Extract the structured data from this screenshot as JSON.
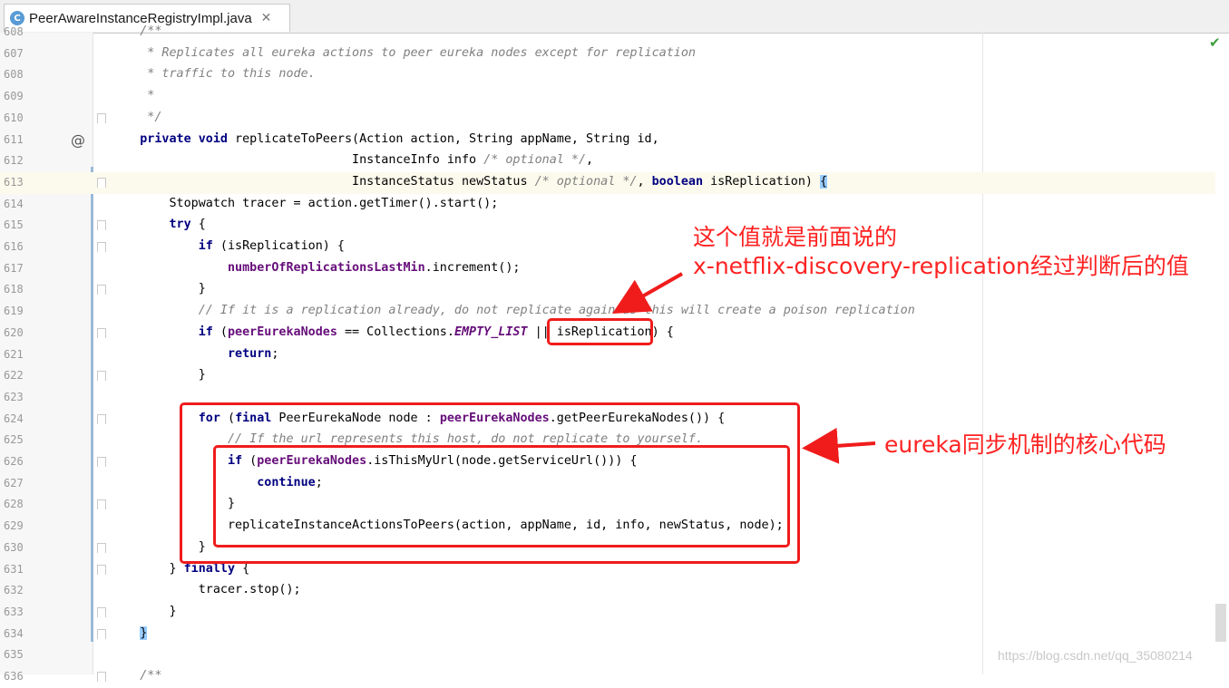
{
  "tab": {
    "icon_letter": "C",
    "filename": "PeerAwareInstanceRegistryImpl.java",
    "close": "✕"
  },
  "editor": {
    "lines": [
      {
        "n": "608",
        "tokens": [
          {
            "t": "    /**",
            "c": "cm"
          }
        ]
      },
      {
        "n": "607",
        "tokens": [
          {
            "t": "     * Replicates all eureka actions to peer eureka nodes except for replication",
            "c": "cm"
          }
        ]
      },
      {
        "n": "608",
        "tokens": [
          {
            "t": "     * traffic to this node.",
            "c": "cm"
          }
        ]
      },
      {
        "n": "609",
        "tokens": [
          {
            "t": "     *",
            "c": "cm"
          }
        ]
      },
      {
        "n": "610",
        "tokens": [
          {
            "t": "     */",
            "c": "cm"
          }
        ]
      },
      {
        "n": "611",
        "tokens": [
          {
            "t": "    "
          },
          {
            "t": "private void",
            "c": "kw"
          },
          {
            "t": " replicateToPeers(Action action, String appName, String id,"
          }
        ]
      },
      {
        "n": "612",
        "tokens": [
          {
            "t": "                                 InstanceInfo info "
          },
          {
            "t": "/* optional */",
            "c": "cm"
          },
          {
            "t": ","
          }
        ]
      },
      {
        "n": "613",
        "tokens": [
          {
            "t": "                                 InstanceStatus newStatus "
          },
          {
            "t": "/* optional */",
            "c": "cm"
          },
          {
            "t": ", "
          },
          {
            "t": "boolean",
            "c": "kw"
          },
          {
            "t": " isReplication) "
          },
          {
            "t": "{",
            "c": "hl"
          }
        ]
      },
      {
        "n": "614",
        "tokens": [
          {
            "t": "        Stopwatch tracer = action.getTimer().start();"
          }
        ]
      },
      {
        "n": "615",
        "tokens": [
          {
            "t": "        "
          },
          {
            "t": "try",
            "c": "kw"
          },
          {
            "t": " {"
          }
        ]
      },
      {
        "n": "616",
        "tokens": [
          {
            "t": "            "
          },
          {
            "t": "if",
            "c": "kw"
          },
          {
            "t": " (isReplication) {"
          }
        ]
      },
      {
        "n": "617",
        "tokens": [
          {
            "t": "                "
          },
          {
            "t": "numberOfReplicationsLastMin",
            "c": "fld"
          },
          {
            "t": ".increment();"
          }
        ]
      },
      {
        "n": "618",
        "tokens": [
          {
            "t": "            }"
          }
        ]
      },
      {
        "n": "619",
        "tokens": [
          {
            "t": "            "
          },
          {
            "t": "// If it is a replication already, do not replicate again as this will create a poison replication",
            "c": "cm"
          }
        ]
      },
      {
        "n": "620",
        "tokens": [
          {
            "t": "            "
          },
          {
            "t": "if",
            "c": "kw"
          },
          {
            "t": " ("
          },
          {
            "t": "peerEurekaNodes",
            "c": "fld"
          },
          {
            "t": " == Collections."
          },
          {
            "t": "EMPTY_LIST",
            "c": "cst"
          },
          {
            "t": " || isReplication) {"
          }
        ]
      },
      {
        "n": "621",
        "tokens": [
          {
            "t": "                "
          },
          {
            "t": "return",
            "c": "kw"
          },
          {
            "t": ";"
          }
        ]
      },
      {
        "n": "622",
        "tokens": [
          {
            "t": "            }"
          }
        ]
      },
      {
        "n": "623",
        "tokens": [
          {
            "t": ""
          }
        ]
      },
      {
        "n": "624",
        "tokens": [
          {
            "t": "            "
          },
          {
            "t": "for",
            "c": "kw"
          },
          {
            "t": " ("
          },
          {
            "t": "final",
            "c": "kw"
          },
          {
            "t": " PeerEurekaNode node : "
          },
          {
            "t": "peerEurekaNodes",
            "c": "fld"
          },
          {
            "t": ".getPeerEurekaNodes()) {"
          }
        ]
      },
      {
        "n": "625",
        "tokens": [
          {
            "t": "                "
          },
          {
            "t": "// If the url represents this host, do not replicate to yourself.",
            "c": "cm"
          }
        ]
      },
      {
        "n": "626",
        "tokens": [
          {
            "t": "                "
          },
          {
            "t": "if",
            "c": "kw"
          },
          {
            "t": " ("
          },
          {
            "t": "peerEurekaNodes",
            "c": "fld"
          },
          {
            "t": ".isThisMyUrl(node.getServiceUrl())) {"
          }
        ]
      },
      {
        "n": "627",
        "tokens": [
          {
            "t": "                    "
          },
          {
            "t": "continue",
            "c": "kw"
          },
          {
            "t": ";"
          }
        ]
      },
      {
        "n": "628",
        "tokens": [
          {
            "t": "                }"
          }
        ]
      },
      {
        "n": "629",
        "tokens": [
          {
            "t": "                replicateInstanceActionsToPeers(action, appName, id, info, newStatus, node);"
          }
        ]
      },
      {
        "n": "630",
        "tokens": [
          {
            "t": "            }"
          }
        ]
      },
      {
        "n": "631",
        "tokens": [
          {
            "t": "        } "
          },
          {
            "t": "finally",
            "c": "kw"
          },
          {
            "t": " {"
          }
        ]
      },
      {
        "n": "632",
        "tokens": [
          {
            "t": "            tracer.stop();"
          }
        ]
      },
      {
        "n": "633",
        "tokens": [
          {
            "t": "        }"
          }
        ]
      },
      {
        "n": "634",
        "tokens": [
          {
            "t": "    "
          },
          {
            "t": "}",
            "c": "hl"
          }
        ]
      },
      {
        "n": "635",
        "tokens": [
          {
            "t": ""
          }
        ]
      },
      {
        "n": "636",
        "tokens": [
          {
            "t": "    /**",
            "c": "cm"
          }
        ]
      }
    ],
    "current_line": "613",
    "override_marker": "@",
    "status_check": "✔"
  },
  "annotations": {
    "note1_line1": "这个值就是前面说的",
    "note1_line2": "x-netflix-discovery-replication经过判断后的值",
    "note2": "eureka同步机制的核心代码",
    "color": "#f01c1c"
  },
  "watermark": "https://blog.csdn.net/qq_35080214"
}
